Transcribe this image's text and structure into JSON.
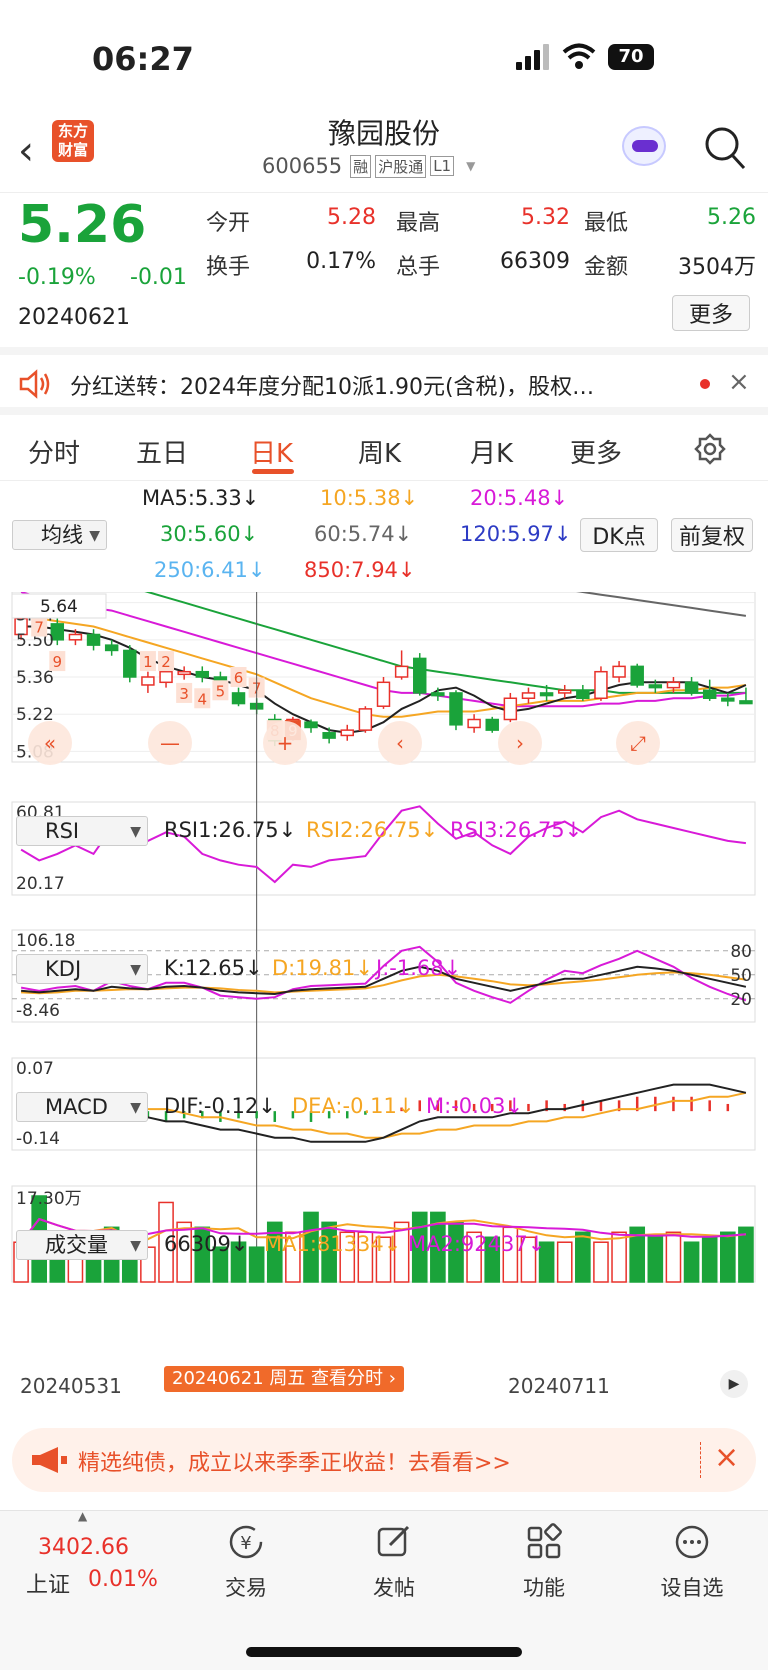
{
  "status_bar": {
    "time": "06:27",
    "battery": "70"
  },
  "header": {
    "logo_text": "东方\n财富",
    "stock_name": "豫园股份",
    "code": "600655",
    "badges": [
      "融",
      "沪股通",
      "L1"
    ]
  },
  "quote": {
    "price": "5.26",
    "change_pct": "-0.19%",
    "change": "-0.01",
    "date": "20240621",
    "fields": [
      {
        "label": "今开",
        "value": "5.28",
        "color": "red"
      },
      {
        "label": "最高",
        "value": "5.32",
        "color": "red"
      },
      {
        "label": "最低",
        "value": "5.26",
        "color": "green"
      },
      {
        "label": "换手",
        "value": "0.17%",
        "color": "black"
      },
      {
        "label": "总手",
        "value": "66309",
        "color": "black"
      },
      {
        "label": "金额",
        "value": "3504万",
        "color": "black"
      }
    ],
    "more_label": "更多"
  },
  "notice": {
    "text": "分红送转：2024年度分配10派1.90元(含税)，股权…"
  },
  "tabs": {
    "items": [
      "分时",
      "五日",
      "日K",
      "周K",
      "月K",
      "更多"
    ],
    "active": "日K"
  },
  "ma_panel": {
    "selector": "均线",
    "dk_label": "DK点",
    "fq_label": "前复权",
    "values": [
      {
        "text": "MA5:5.33↓",
        "color": "#222"
      },
      {
        "text": "10:5.38↓",
        "color": "#f5a623"
      },
      {
        "text": "20:5.48↓",
        "color": "#d81ad8"
      },
      {
        "text": "30:5.60↓",
        "color": "#1aa33a"
      },
      {
        "text": "60:5.74↓",
        "color": "#666"
      },
      {
        "text": "120:5.97↓",
        "color": "#2d3bc4"
      },
      {
        "text": "250:6.41↓",
        "color": "#5ab4f0"
      },
      {
        "text": "850:7.94↓",
        "color": "#e8312a"
      }
    ]
  },
  "kline": {
    "y_labels": [
      "5.64",
      "5.50",
      "5.36",
      "5.22",
      "5.08"
    ],
    "markers": [
      "1",
      "2",
      "3",
      "4",
      "5",
      "6",
      "7",
      "8",
      "9",
      "7",
      "9"
    ]
  },
  "rsi": {
    "selector": "RSI",
    "rsi1": "RSI1:26.75↓",
    "rsi2": "RSI2:26.75↓",
    "rsi3": "RSI3:26.75↓",
    "y_high": "60.81",
    "y_low": "20.17"
  },
  "kdj": {
    "selector": "KDJ",
    "k": "K:12.65↓",
    "d": "D:19.81↓",
    "j": "J:-1.68↓",
    "y_high": "106.18",
    "y_low": "-8.46",
    "levels": [
      "80",
      "50",
      "20"
    ]
  },
  "macd": {
    "selector": "MACD",
    "dif": "DIF:-0.12↓",
    "dea": "DEA:-0.11↓",
    "m": "M:-0.03↓",
    "y_high": "0.07",
    "y_low": "-0.14"
  },
  "volume": {
    "selector": "成交量",
    "vol": "66309↓",
    "ma1": "MA1:81334↓",
    "ma2": "MA2:92437↓",
    "y_high": "17.30万",
    "dates": [
      "20240531",
      "20240621",
      "20240711"
    ],
    "tooltip": "20240621 周五 查看分时"
  },
  "chart_data": {
    "type": "candlestick",
    "ylim": [
      5.08,
      5.64
    ],
    "candles": [
      {
        "o": 5.52,
        "c": 5.58,
        "h": 5.6,
        "l": 5.5
      },
      {
        "o": 5.58,
        "c": 5.55,
        "h": 5.6,
        "l": 5.52
      },
      {
        "o": 5.56,
        "c": 5.5,
        "h": 5.58,
        "l": 5.48
      },
      {
        "o": 5.5,
        "c": 5.52,
        "h": 5.54,
        "l": 5.48
      },
      {
        "o": 5.52,
        "c": 5.48,
        "h": 5.54,
        "l": 5.46
      },
      {
        "o": 5.48,
        "c": 5.46,
        "h": 5.5,
        "l": 5.44
      },
      {
        "o": 5.46,
        "c": 5.36,
        "h": 5.48,
        "l": 5.34
      },
      {
        "o": 5.33,
        "c": 5.36,
        "h": 5.38,
        "l": 5.3
      },
      {
        "o": 5.34,
        "c": 5.38,
        "h": 5.4,
        "l": 5.32
      },
      {
        "o": 5.37,
        "c": 5.38,
        "h": 5.4,
        "l": 5.35
      },
      {
        "o": 5.38,
        "c": 5.36,
        "h": 5.4,
        "l": 5.34
      },
      {
        "o": 5.36,
        "c": 5.3,
        "h": 5.38,
        "l": 5.28
      },
      {
        "o": 5.3,
        "c": 5.26,
        "h": 5.32,
        "l": 5.25
      },
      {
        "o": 5.26,
        "c": 5.24,
        "h": 5.28,
        "l": 5.22
      },
      {
        "o": 5.2,
        "c": 5.12,
        "h": 5.22,
        "l": 5.1
      },
      {
        "o": 5.13,
        "c": 5.2,
        "h": 5.21,
        "l": 5.12
      },
      {
        "o": 5.19,
        "c": 5.17,
        "h": 5.2,
        "l": 5.15
      },
      {
        "o": 5.15,
        "c": 5.13,
        "h": 5.17,
        "l": 5.11
      },
      {
        "o": 5.14,
        "c": 5.16,
        "h": 5.18,
        "l": 5.12
      },
      {
        "o": 5.16,
        "c": 5.24,
        "h": 5.25,
        "l": 5.15
      },
      {
        "o": 5.25,
        "c": 5.34,
        "h": 5.36,
        "l": 5.24
      },
      {
        "o": 5.36,
        "c": 5.4,
        "h": 5.46,
        "l": 5.35
      },
      {
        "o": 5.43,
        "c": 5.3,
        "h": 5.45,
        "l": 5.29
      },
      {
        "o": 5.3,
        "c": 5.29,
        "h": 5.32,
        "l": 5.27
      },
      {
        "o": 5.3,
        "c": 5.18,
        "h": 5.31,
        "l": 5.16
      },
      {
        "o": 5.17,
        "c": 5.2,
        "h": 5.22,
        "l": 5.15
      },
      {
        "o": 5.2,
        "c": 5.16,
        "h": 5.21,
        "l": 5.15
      },
      {
        "o": 5.2,
        "c": 5.28,
        "h": 5.3,
        "l": 5.19
      },
      {
        "o": 5.28,
        "c": 5.3,
        "h": 5.32,
        "l": 5.26
      },
      {
        "o": 5.3,
        "c": 5.29,
        "h": 5.33,
        "l": 5.27
      },
      {
        "o": 5.3,
        "c": 5.31,
        "h": 5.33,
        "l": 5.28
      },
      {
        "o": 5.31,
        "c": 5.28,
        "h": 5.33,
        "l": 5.27
      },
      {
        "o": 5.28,
        "c": 5.38,
        "h": 5.4,
        "l": 5.27
      },
      {
        "o": 5.36,
        "c": 5.4,
        "h": 5.42,
        "l": 5.34
      },
      {
        "o": 5.4,
        "c": 5.33,
        "h": 5.41,
        "l": 5.32
      },
      {
        "o": 5.33,
        "c": 5.32,
        "h": 5.35,
        "l": 5.3
      },
      {
        "o": 5.32,
        "c": 5.34,
        "h": 5.36,
        "l": 5.3
      },
      {
        "o": 5.34,
        "c": 5.3,
        "h": 5.36,
        "l": 5.29
      },
      {
        "o": 5.31,
        "c": 5.28,
        "h": 5.35,
        "l": 5.27
      },
      {
        "o": 5.28,
        "c": 5.27,
        "h": 5.3,
        "l": 5.25
      },
      {
        "o": 5.27,
        "c": 5.26,
        "h": 5.32,
        "l": 5.26
      }
    ],
    "ma5": [
      5.55,
      5.55,
      5.54,
      5.53,
      5.52,
      5.5,
      5.47,
      5.43,
      5.4,
      5.38,
      5.36,
      5.35,
      5.33,
      5.31,
      5.26,
      5.22,
      5.19,
      5.16,
      5.15,
      5.16,
      5.19,
      5.24,
      5.27,
      5.31,
      5.32,
      5.29,
      5.25,
      5.23,
      5.24,
      5.26,
      5.28,
      5.29,
      5.31,
      5.33,
      5.34,
      5.34,
      5.34,
      5.34,
      5.32,
      5.3,
      5.33
    ],
    "ma10": [
      5.6,
      5.58,
      5.57,
      5.56,
      5.55,
      5.53,
      5.51,
      5.49,
      5.47,
      5.45,
      5.43,
      5.41,
      5.39,
      5.37,
      5.34,
      5.31,
      5.28,
      5.26,
      5.24,
      5.22,
      5.21,
      5.21,
      5.22,
      5.23,
      5.23,
      5.23,
      5.24,
      5.25,
      5.26,
      5.27,
      5.27,
      5.27,
      5.28,
      5.29,
      5.3,
      5.3,
      5.31,
      5.31,
      5.32,
      5.32,
      5.33
    ],
    "ma20": [
      5.68,
      5.66,
      5.65,
      5.64,
      5.62,
      5.61,
      5.59,
      5.57,
      5.55,
      5.53,
      5.51,
      5.49,
      5.47,
      5.45,
      5.43,
      5.41,
      5.39,
      5.37,
      5.35,
      5.33,
      5.31,
      5.3,
      5.3,
      5.29,
      5.28,
      5.27,
      5.26,
      5.25,
      5.25,
      5.25,
      5.25,
      5.25,
      5.26,
      5.26,
      5.27,
      5.27,
      5.28,
      5.28,
      5.29,
      5.29,
      5.3
    ],
    "ma30": [
      5.78,
      5.77,
      5.76,
      5.75,
      5.73,
      5.72,
      5.7,
      5.68,
      5.66,
      5.64,
      5.62,
      5.6,
      5.58,
      5.56,
      5.54,
      5.52,
      5.5,
      5.48,
      5.46,
      5.44,
      5.42,
      5.4,
      5.39,
      5.38,
      5.37,
      5.36,
      5.35,
      5.34,
      5.33,
      5.32,
      5.31,
      5.31,
      5.31,
      5.3,
      5.3,
      5.3,
      5.3,
      5.3,
      5.3,
      5.3,
      5.3
    ],
    "ma60": [
      5.9,
      5.9,
      5.9,
      5.89,
      5.89,
      5.88,
      5.88,
      5.87,
      5.86,
      5.86,
      5.85,
      5.84,
      5.84,
      5.83,
      5.82,
      5.81,
      5.8,
      5.79,
      5.78,
      5.77,
      5.76,
      5.75,
      5.75,
      5.75,
      5.74,
      5.74,
      5.73,
      5.72,
      5.71,
      5.7,
      5.69,
      5.68,
      5.67,
      5.66,
      5.65,
      5.64,
      5.63,
      5.62,
      5.61,
      5.6,
      5.59
    ],
    "rsi": [
      40,
      35,
      38,
      42,
      38,
      50,
      47,
      44,
      48,
      46,
      38,
      35,
      33,
      32,
      25,
      33,
      32,
      35,
      36,
      37,
      48,
      58,
      60,
      52,
      45,
      48,
      42,
      38,
      46,
      50,
      53,
      48,
      55,
      58,
      54,
      52,
      50,
      48,
      46,
      44,
      43
    ],
    "k": [
      30,
      28,
      30,
      32,
      30,
      35,
      33,
      32,
      35,
      36,
      34,
      30,
      28,
      27,
      26,
      30,
      32,
      33,
      34,
      35,
      45,
      55,
      60,
      55,
      45,
      40,
      35,
      30,
      35,
      40,
      45,
      45,
      50,
      55,
      60,
      58,
      55,
      50,
      45,
      40,
      35
    ],
    "d": [
      28,
      27,
      28,
      30,
      30,
      31,
      32,
      32,
      33,
      34,
      34,
      33,
      31,
      30,
      28,
      29,
      30,
      31,
      32,
      33,
      37,
      43,
      48,
      50,
      48,
      45,
      42,
      38,
      37,
      38,
      40,
      42,
      44,
      47,
      50,
      52,
      53,
      52,
      50,
      47,
      44
    ],
    "j": [
      34,
      30,
      34,
      36,
      30,
      42,
      36,
      32,
      40,
      40,
      34,
      24,
      22,
      20,
      22,
      32,
      36,
      37,
      38,
      39,
      61,
      80,
      85,
      66,
      40,
      30,
      22,
      15,
      30,
      44,
      55,
      52,
      62,
      70,
      80,
      70,
      60,
      46,
      35,
      26,
      18
    ],
    "dif": [
      -0.02,
      -0.03,
      -0.04,
      -0.04,
      -0.05,
      -0.05,
      -0.06,
      -0.07,
      -0.08,
      -0.08,
      -0.09,
      -0.1,
      -0.1,
      -0.11,
      -0.12,
      -0.12,
      -0.13,
      -0.13,
      -0.13,
      -0.13,
      -0.12,
      -0.1,
      -0.08,
      -0.07,
      -0.07,
      -0.07,
      -0.07,
      -0.06,
      -0.06,
      -0.05,
      -0.05,
      -0.04,
      -0.03,
      -0.02,
      -0.01,
      0.0,
      0.01,
      0.01,
      0.01,
      0.0,
      -0.01
    ],
    "dea": [
      -0.01,
      -0.02,
      -0.02,
      -0.03,
      -0.03,
      -0.04,
      -0.04,
      -0.05,
      -0.05,
      -0.06,
      -0.07,
      -0.07,
      -0.08,
      -0.09,
      -0.09,
      -0.1,
      -0.1,
      -0.11,
      -0.11,
      -0.12,
      -0.12,
      -0.11,
      -0.11,
      -0.1,
      -0.1,
      -0.09,
      -0.09,
      -0.09,
      -0.08,
      -0.08,
      -0.07,
      -0.07,
      -0.06,
      -0.05,
      -0.05,
      -0.04,
      -0.03,
      -0.03,
      -0.02,
      -0.02,
      -0.01
    ],
    "volume": [
      8,
      17.3,
      9,
      7,
      10,
      11,
      8,
      7,
      16,
      12,
      11,
      7,
      8,
      7,
      12,
      10,
      14,
      12,
      10,
      10,
      9,
      12,
      14,
      14,
      12,
      10,
      9,
      11,
      9,
      8,
      8,
      10,
      8,
      10,
      11,
      9,
      10,
      8,
      9,
      10,
      11
    ]
  },
  "promo": {
    "text": "精选纯债，成立以来季季正收益！去看看>>"
  },
  "bottom_nav": {
    "index_value": "3402.66",
    "index_name": "上证",
    "index_change": "0.01%",
    "items": [
      {
        "label": "交易",
        "icon": "yen-icon"
      },
      {
        "label": "发帖",
        "icon": "edit-icon"
      },
      {
        "label": "功能",
        "icon": "grid-icon"
      },
      {
        "label": "设自选",
        "icon": "more-icon"
      }
    ]
  }
}
